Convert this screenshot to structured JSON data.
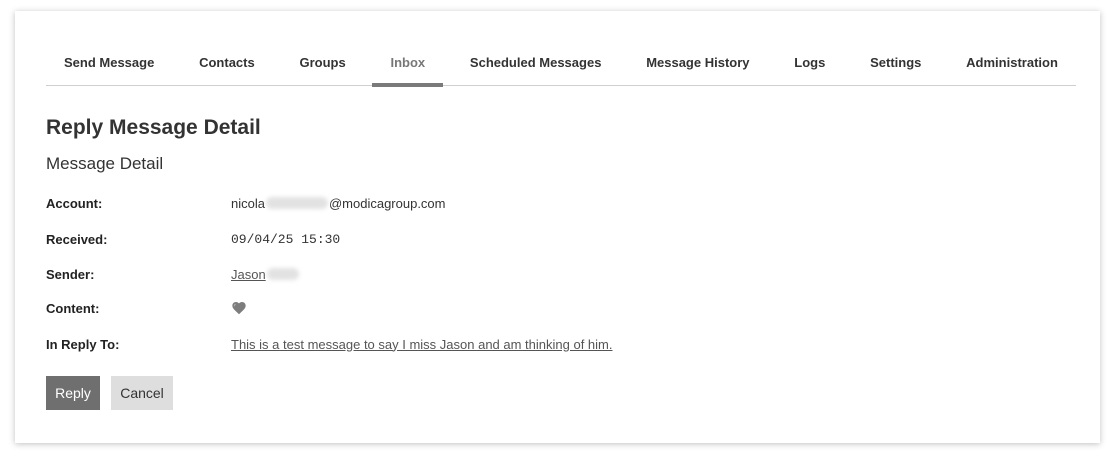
{
  "nav": {
    "tabs": [
      {
        "label": "Send Message"
      },
      {
        "label": "Contacts"
      },
      {
        "label": "Groups"
      },
      {
        "label": "Inbox",
        "active": true
      },
      {
        "label": "Scheduled Messages"
      },
      {
        "label": "Message History"
      },
      {
        "label": "Logs"
      },
      {
        "label": "Settings"
      },
      {
        "label": "Administration"
      }
    ]
  },
  "page": {
    "title": "Reply Message Detail",
    "section_title": "Message Detail"
  },
  "detail": {
    "account_label": "Account:",
    "account_prefix": "nicola",
    "account_suffix": "@modicagroup.com",
    "received_label": "Received:",
    "received_value": "09/04/25 15:30",
    "sender_label": "Sender:",
    "sender_value": "Jason",
    "content_label": "Content:",
    "content_icon": "grey-heart-icon",
    "in_reply_to_label": "In Reply To:",
    "in_reply_to_value": "This is a test message to say I miss Jason and am thinking of him."
  },
  "actions": {
    "reply_label": "Reply",
    "cancel_label": "Cancel"
  },
  "colors": {
    "active_tab_indicator": "#7a7a7a",
    "reply_button": "#6f6f6f",
    "cancel_button": "#dedede",
    "heart": "#7d7d7d"
  }
}
